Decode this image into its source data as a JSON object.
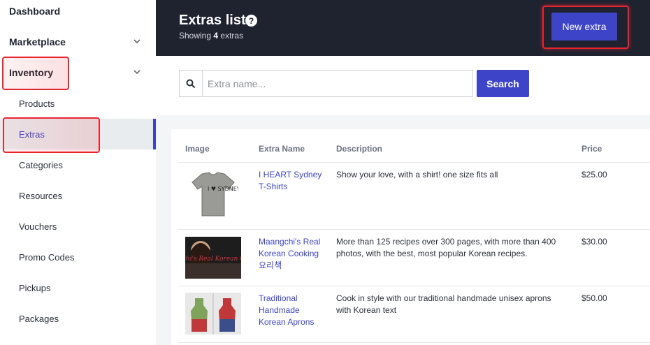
{
  "sidebar": {
    "items": [
      {
        "label": "Dashboard"
      },
      {
        "label": "Marketplace"
      },
      {
        "label": "Inventory"
      },
      {
        "label": "Products"
      },
      {
        "label": "Extras"
      },
      {
        "label": "Categories"
      },
      {
        "label": "Resources"
      },
      {
        "label": "Vouchers"
      },
      {
        "label": "Promo Codes"
      },
      {
        "label": "Pickups"
      },
      {
        "label": "Packages"
      }
    ]
  },
  "header": {
    "title": "Extras list",
    "help_glyph": "?",
    "showing_prefix": "Showing",
    "showing_count": "4",
    "showing_suffix": "extras",
    "new_button": "New extra"
  },
  "search": {
    "placeholder": "Extra name...",
    "button": "Search"
  },
  "table": {
    "columns": [
      "Image",
      "Extra Name",
      "Description",
      "Price"
    ],
    "rows": [
      {
        "name_lines": [
          "I HEART Sydney",
          "T-Shirts"
        ],
        "description_lines": [
          "Show your love, with a shirt! one size fits all"
        ],
        "price": "$25.00",
        "image_text": "I ♥ SYDNEY"
      },
      {
        "name_lines": [
          "Maangchi's Real",
          "Korean Cooking",
          "요리책"
        ],
        "description_lines": [
          "More than 125 recipes over 300 pages, with more than 400",
          "photos, with the best, most popular Korean recipes."
        ],
        "price": "$30.00",
        "image_text": "Maangchi's Real Korean Cooking"
      },
      {
        "name_lines": [
          "Traditional",
          "Handmade",
          "Korean Aprons"
        ],
        "description_lines": [
          "Cook in style with our traditional handmade unisex aprons",
          "with Korean text"
        ],
        "price": "$50.00"
      }
    ]
  }
}
